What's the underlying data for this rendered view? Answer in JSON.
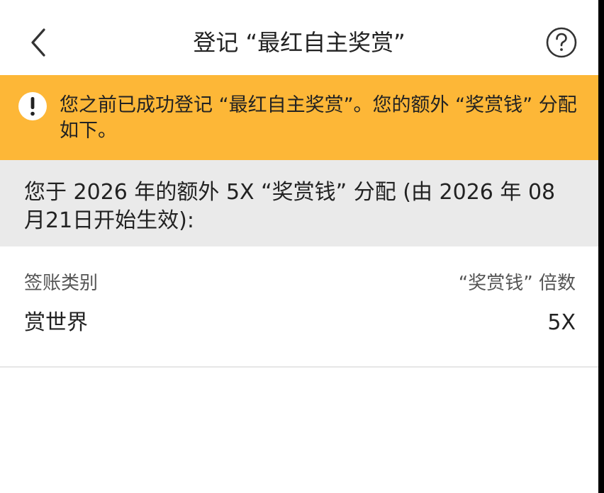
{
  "header": {
    "title": "登记 “最红自主奖赏”"
  },
  "notice": {
    "text": "您之前已成功登记 “最红自主奖赏”。您的额外 “奖赏钱” 分配如下。"
  },
  "section": {
    "text": "您于 2026 年的额外 5X “奖赏钱” 分配 (由 2026 年 08 月21日开始生效):"
  },
  "table": {
    "left_header": "签账类别",
    "right_header": "“奖赏钱” 倍数",
    "rows": [
      {
        "category": "赏世界",
        "multiplier": "5X"
      }
    ]
  },
  "colors": {
    "notice_bg": "#FDB737",
    "section_bg": "#EAEAEA",
    "text": "#222222"
  },
  "icons": {
    "back": "chevron-left-icon",
    "help": "question-circle-icon",
    "alert": "exclamation-circle-icon"
  }
}
